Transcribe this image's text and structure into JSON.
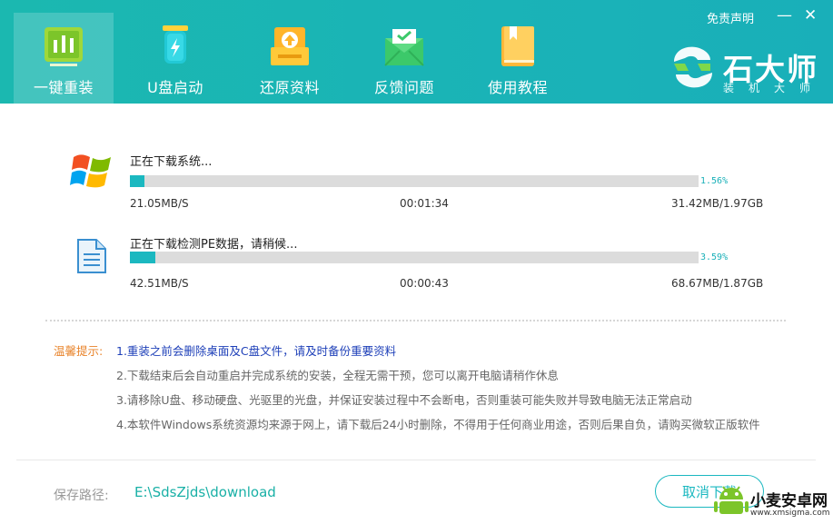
{
  "header": {
    "tabs": [
      {
        "label": "一键重装",
        "icon": "chart-icon",
        "active": true
      },
      {
        "label": "U盘启动",
        "icon": "usb-icon",
        "active": false
      },
      {
        "label": "还原资料",
        "icon": "restore-icon",
        "active": false
      },
      {
        "label": "反馈问题",
        "icon": "mail-icon",
        "active": false
      },
      {
        "label": "使用教程",
        "icon": "book-icon",
        "active": false
      }
    ],
    "disclaimer": "免责声明",
    "minimize": "—",
    "close": "✕",
    "brand": {
      "title": "石大师",
      "subtitle": "装机大师"
    }
  },
  "downloads": [
    {
      "title": "正在下载系统...",
      "icon": "windows-logo-icon",
      "progress": 0.0156,
      "percent": "1.56%",
      "speed": "21.05MB/S",
      "time": "00:01:34",
      "size": "31.42MB/1.97GB"
    },
    {
      "title": "正在下载检测PE数据，请稍候...",
      "icon": "document-icon",
      "progress": 0.0359,
      "percent": "3.59%",
      "speed": "42.51MB/S",
      "time": "00:00:43",
      "size": "68.67MB/1.87GB"
    }
  ],
  "tips": {
    "label": "温馨提示:",
    "items": [
      "1.重装之前会删除桌面及C盘文件，请及时备份重要资料",
      "2.下载结束后会自动重启并完成系统的安装，全程无需干预，您可以离开电脑请稍作休息",
      "3.请移除U盘、移动硬盘、光驱里的光盘，并保证安装过程中不会断电，否则重装可能失败并导致电脑无法正常启动",
      "4.本软件Windows系统资源均来源于网上，请下载后24小时删除，不得用于任何商业用途，否则后果自负，请购买微软正版软件"
    ]
  },
  "footer": {
    "save_label": "保存路径:",
    "save_path": "E:\\SdsZjds\\download",
    "cancel_label": "取消下载"
  },
  "watermark": {
    "title": "小麦安卓网",
    "url": "www.xmsigma.com"
  },
  "colors": {
    "accent": "#1bb8c0",
    "header": "#1ab3b7",
    "tip_highlight": "#1d3fb8",
    "tip_label": "#e8832a"
  }
}
